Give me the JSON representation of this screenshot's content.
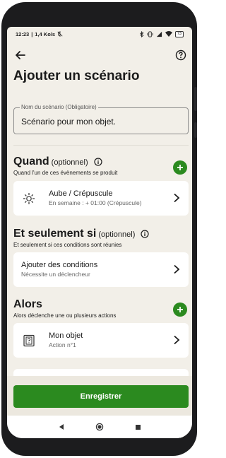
{
  "status": {
    "time": "12:23",
    "speed": "1,4 Ko/s",
    "battery": "73"
  },
  "page": {
    "title": "Ajouter un scénario"
  },
  "name_field": {
    "label": "Nom du scénario (Obligatoire)",
    "value": "Scénario pour mon objet."
  },
  "quand": {
    "title": "Quand",
    "optional": "(optionnel)",
    "subtitle": "Quand l'un de ces évènements se produit",
    "card": {
      "title": "Aube / Crépuscule",
      "subtitle": "En semaine : + 01:00 (Crépuscule)",
      "icon": "sun-icon"
    }
  },
  "seulement": {
    "title": "Et seulement si",
    "optional": "(optionnel)",
    "subtitle": "Et seulement si ces conditions sont réunies",
    "card": {
      "title": "Ajouter des conditions",
      "subtitle": "Nécessite un déclencheur"
    }
  },
  "alors": {
    "title": "Alors",
    "subtitle": "Alors déclenche une ou plusieurs actions",
    "card": {
      "title": "Mon objet",
      "subtitle": "Action n°1",
      "icon": "device-icon"
    }
  },
  "footer": {
    "save_label": "Enregistrer"
  },
  "colors": {
    "accent": "#2b8a1f",
    "background": "#f2efe8"
  }
}
